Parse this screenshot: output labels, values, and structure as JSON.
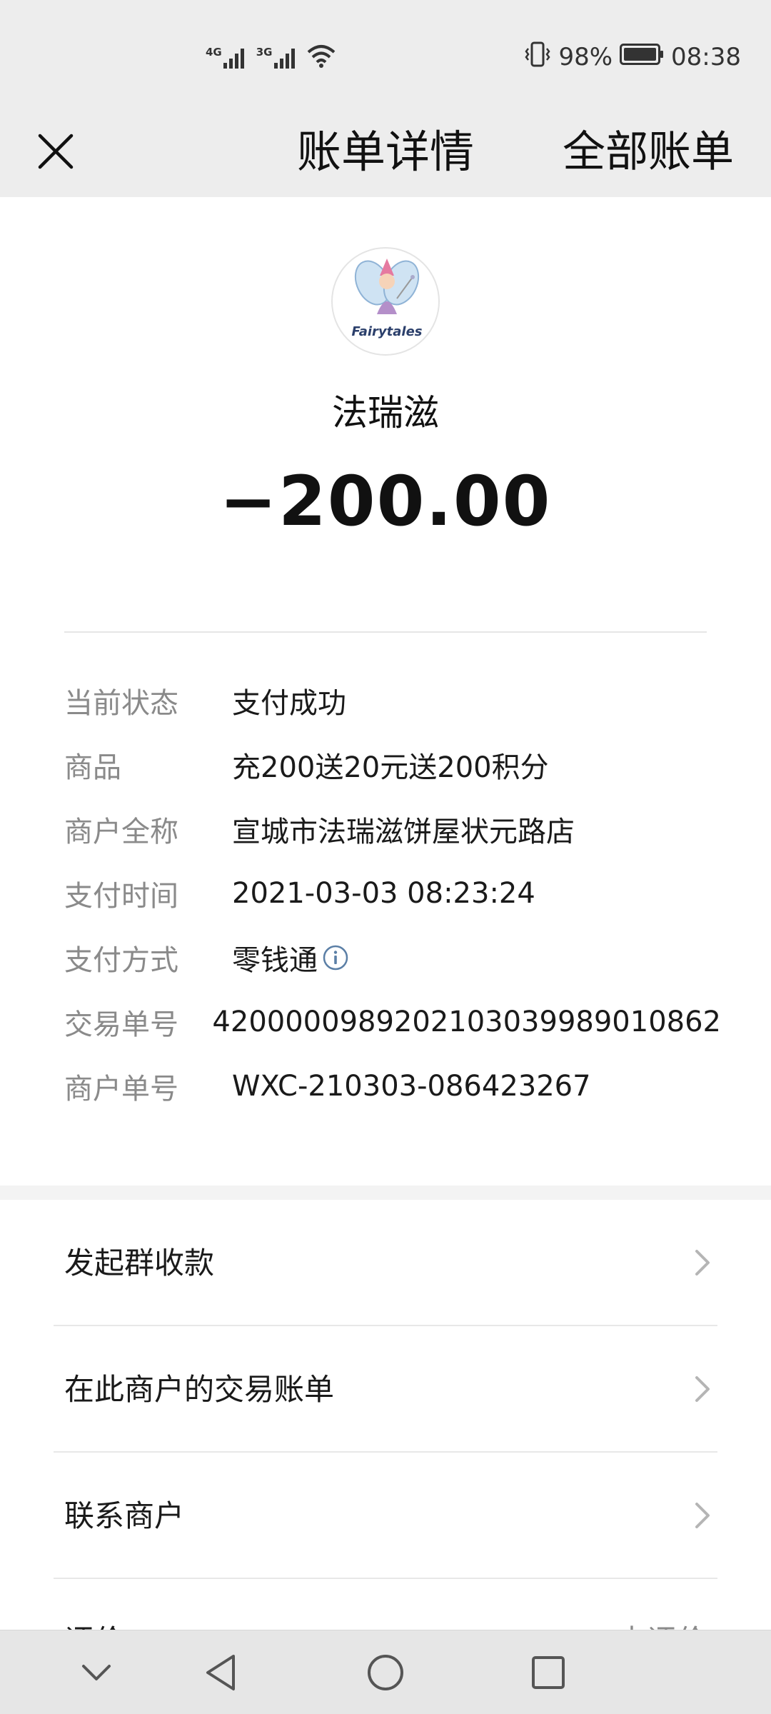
{
  "status_bar": {
    "network_1": "4G",
    "network_2": "3G",
    "battery_percent": "98%",
    "time": "08:38",
    "icons": [
      "signal-icon",
      "wifi-icon",
      "vibrate-icon",
      "battery-icon"
    ]
  },
  "nav": {
    "title": "账单详情",
    "right_action": "全部账单",
    "close_icon": "close-icon"
  },
  "header": {
    "logo_text": "Fairytales",
    "merchant_name": "法瑞滋",
    "amount": "−200.00"
  },
  "details": [
    {
      "label": "当前状态",
      "value": "支付成功"
    },
    {
      "label": "商品",
      "value": "充200送20元送200积分"
    },
    {
      "label": "商户全称",
      "value": "宣城市法瑞滋饼屋状元路店"
    },
    {
      "label": "支付时间",
      "value": "2021-03-03 08:23:24"
    },
    {
      "label": "支付方式",
      "value": "零钱通"
    },
    {
      "label": "交易单号",
      "value": "4200000989202103039989010862"
    },
    {
      "label": "商户单号",
      "value": "WXC-210303-086423267"
    }
  ],
  "menu": [
    {
      "label": "发起群收款"
    },
    {
      "label": "在此商户的交易账单"
    },
    {
      "label": "联系商户"
    }
  ],
  "partial_row": {
    "label": "评价",
    "value": "去评价"
  },
  "colors": {
    "bar_bg": "#ededed",
    "label_gray": "#8a8a8a",
    "text": "#1a1a1a",
    "info_blue": "#5b7fa6"
  }
}
